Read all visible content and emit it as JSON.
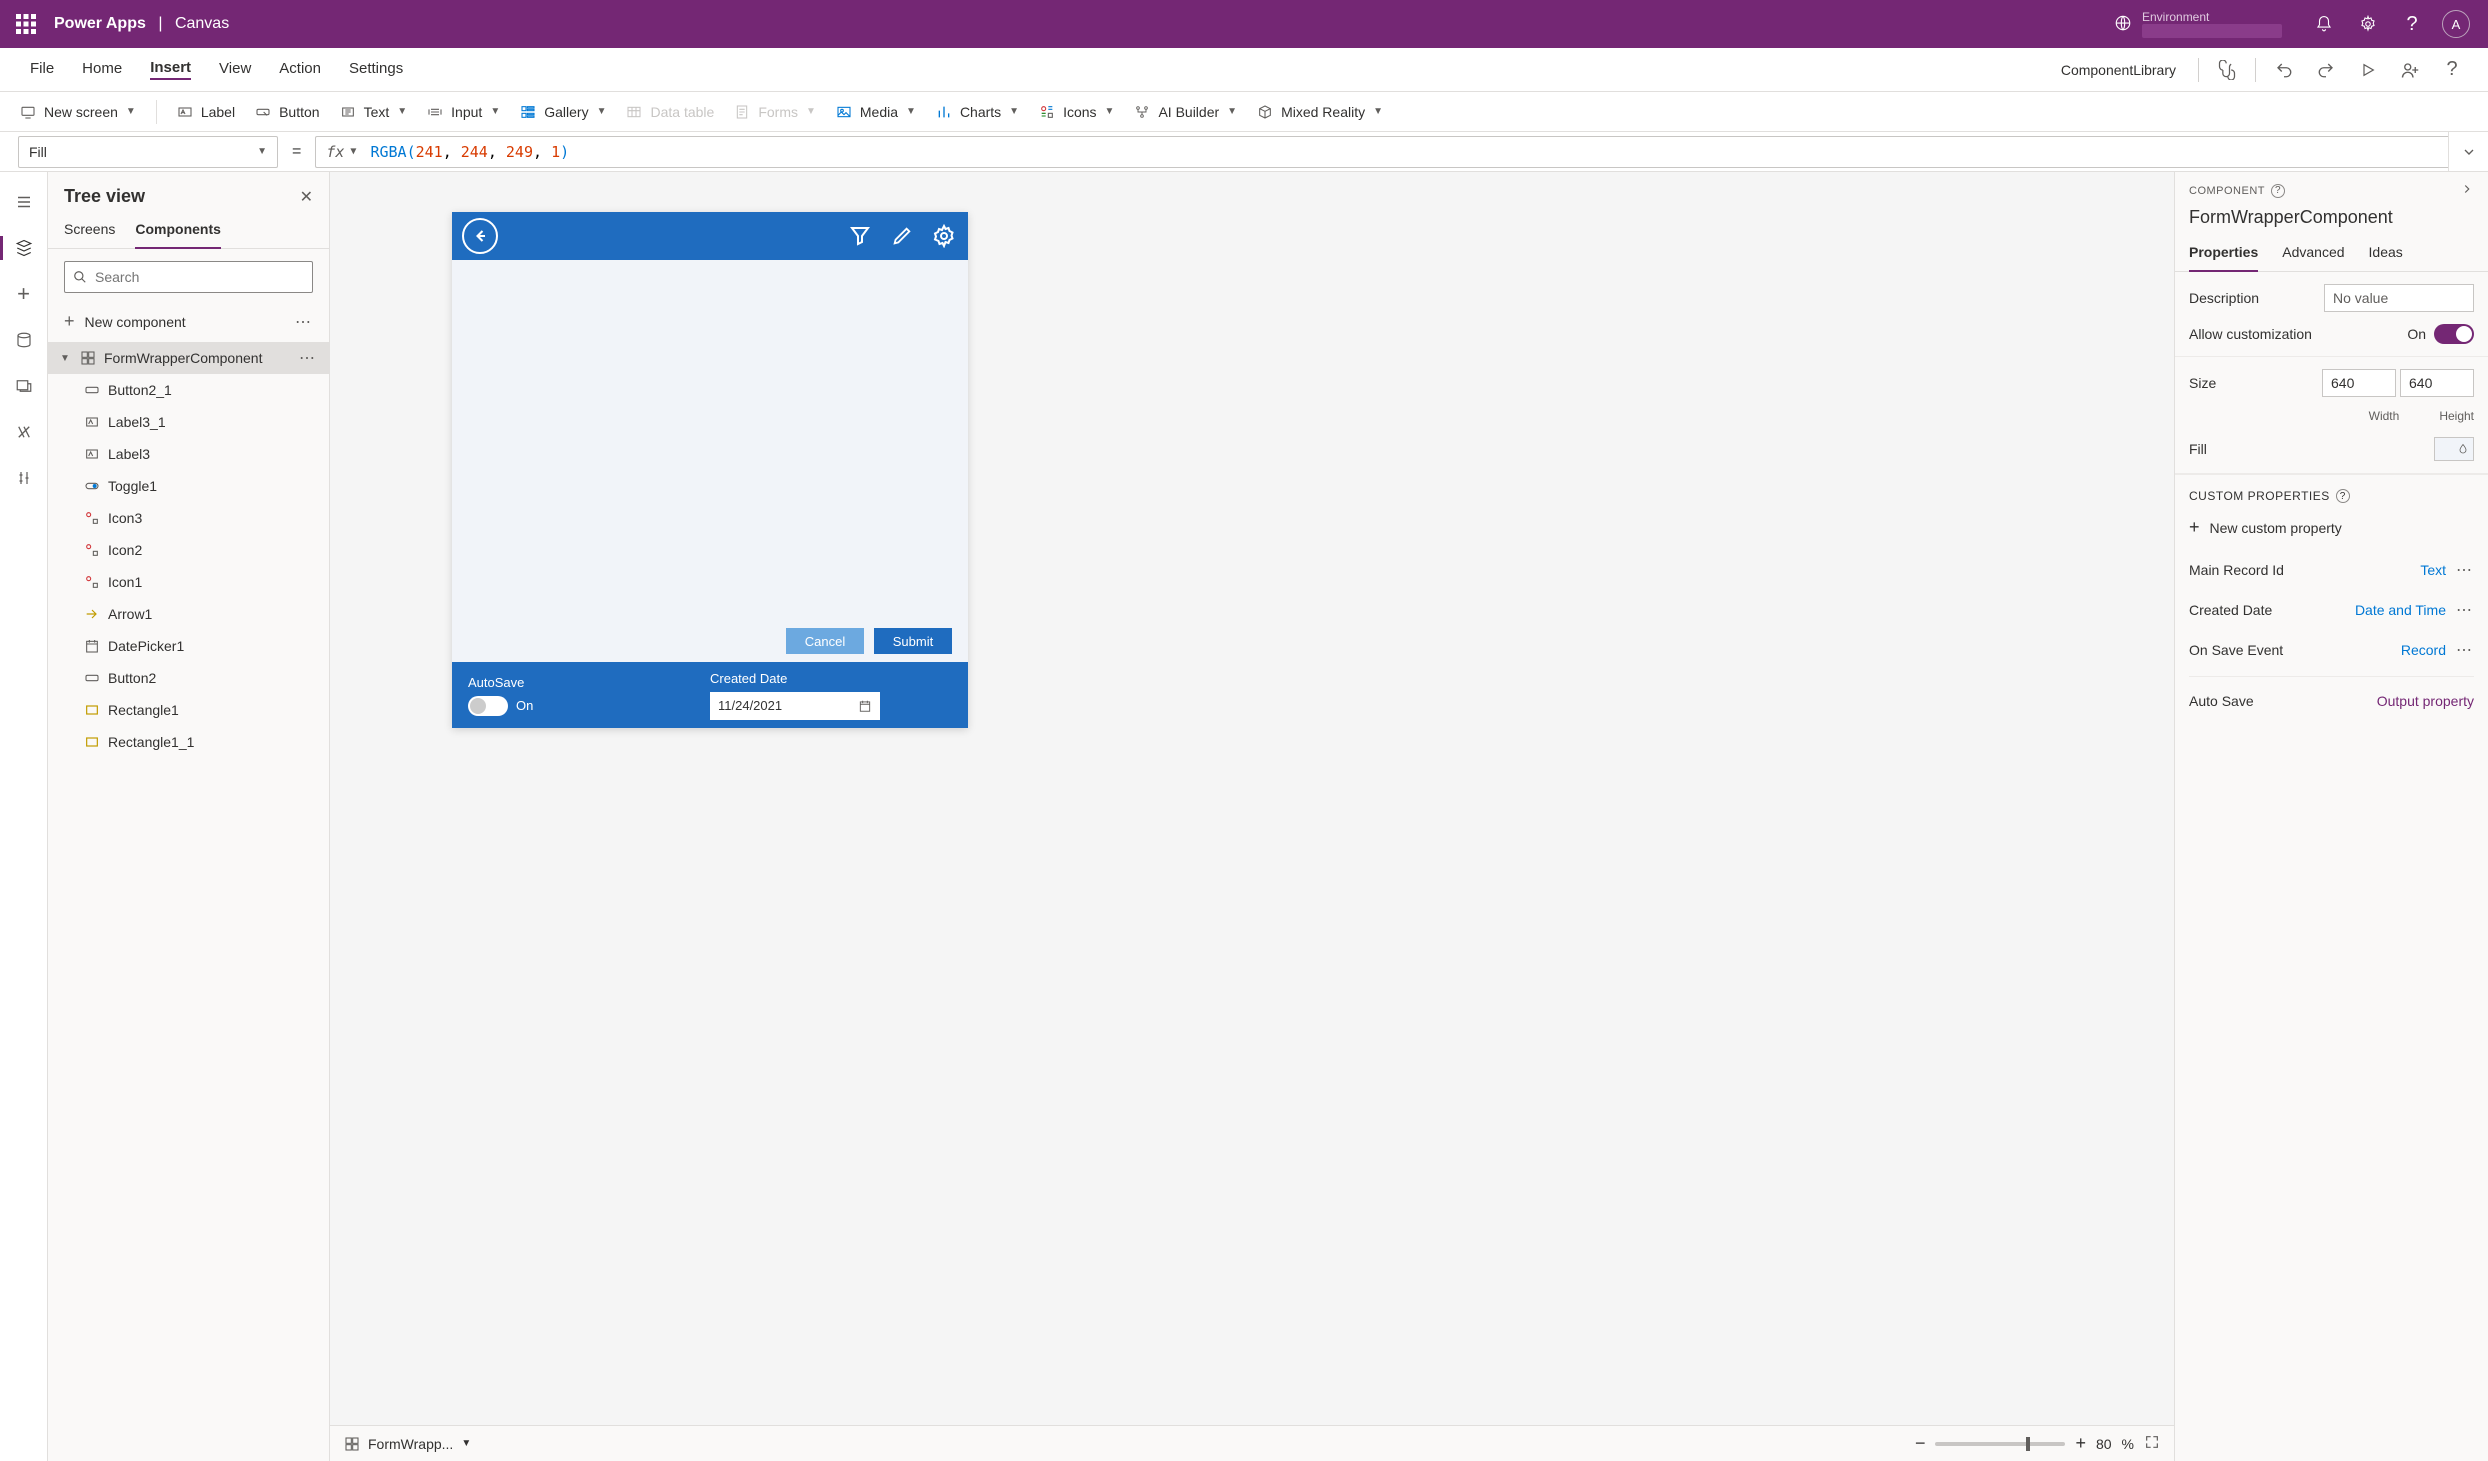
{
  "header": {
    "app": "Power Apps",
    "section": "Canvas",
    "environment_label": "Environment",
    "avatar_letter": "A"
  },
  "menubar": {
    "items": [
      "File",
      "Home",
      "Insert",
      "View",
      "Action",
      "Settings"
    ],
    "active_index": 2,
    "component_library": "ComponentLibrary"
  },
  "toolbar": {
    "new_screen": "New screen",
    "label": "Label",
    "button": "Button",
    "text": "Text",
    "input": "Input",
    "gallery": "Gallery",
    "data_table": "Data table",
    "forms": "Forms",
    "media": "Media",
    "charts": "Charts",
    "icons": "Icons",
    "ai_builder": "AI Builder",
    "mixed_reality": "Mixed Reality"
  },
  "formula": {
    "property": "Fill",
    "fx": "fx",
    "expression_fn": "RGBA",
    "args": [
      "241",
      "244",
      "249",
      "1"
    ]
  },
  "tree": {
    "title": "Tree view",
    "tabs": [
      "Screens",
      "Components"
    ],
    "active_tab": 1,
    "search_placeholder": "Search",
    "new_component": "New component",
    "root": "FormWrapperComponent",
    "children": [
      "Button2_1",
      "Label3_1",
      "Label3",
      "Toggle1",
      "Icon3",
      "Icon2",
      "Icon1",
      "Arrow1",
      "DatePicker1",
      "Button2",
      "Rectangle1",
      "Rectangle1_1"
    ]
  },
  "canvas": {
    "autosave_label": "AutoSave",
    "toggle_text": "On",
    "created_date_label": "Created Date",
    "date_value": "11/24/2021",
    "cancel": "Cancel",
    "submit": "Submit"
  },
  "status": {
    "breadcrumb": "FormWrapp...",
    "zoom": "80",
    "zoom_unit": "%"
  },
  "props": {
    "caption": "COMPONENT",
    "title": "FormWrapperComponent",
    "tabs": [
      "Properties",
      "Advanced",
      "Ideas"
    ],
    "active_tab": 0,
    "description_label": "Description",
    "description_placeholder": "No value",
    "allow_custom_label": "Allow customization",
    "allow_custom_value": "On",
    "size_label": "Size",
    "width_value": "640",
    "height_value": "640",
    "width_label": "Width",
    "height_label": "Height",
    "fill_label": "Fill",
    "custom_props_header": "CUSTOM PROPERTIES",
    "new_prop": "New custom property",
    "rows": [
      {
        "name": "Main Record Id",
        "type": "Text"
      },
      {
        "name": "Created Date",
        "type": "Date and Time"
      },
      {
        "name": "On Save Event",
        "type": "Record"
      },
      {
        "name": "Auto Save",
        "type": "Output property"
      }
    ]
  },
  "colors": {
    "accent": "#742774",
    "link": "#0078d4",
    "canvas_fill": "#f1f4f9",
    "blue_bar": "#1f6cbf"
  }
}
